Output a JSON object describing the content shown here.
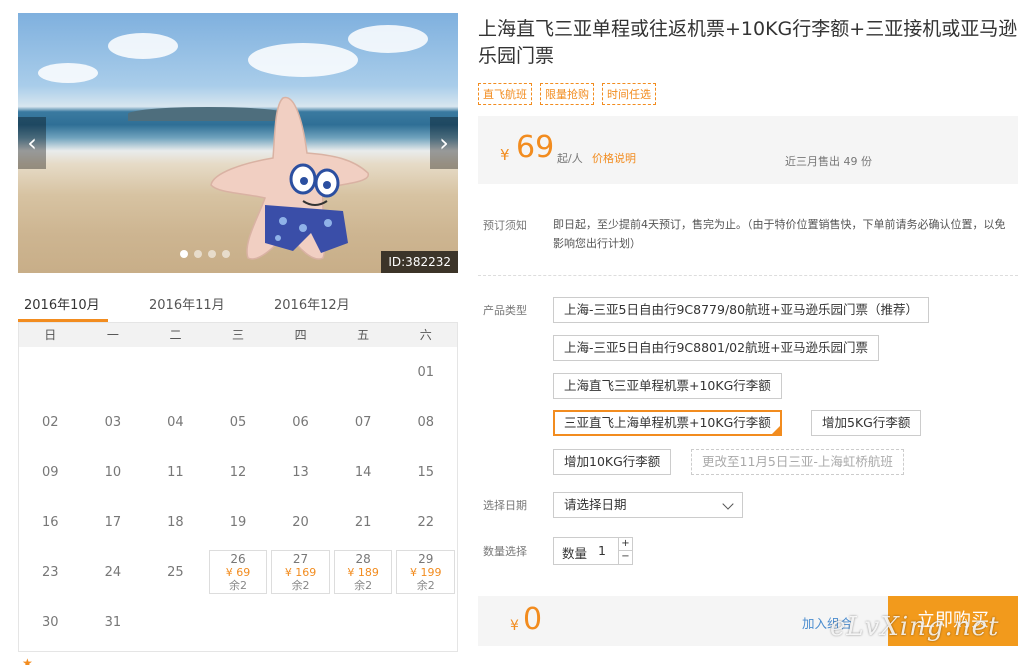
{
  "gallery": {
    "id_label": "ID:382232",
    "prev_icon": "‹",
    "next_icon": "›"
  },
  "calendar": {
    "tabs": [
      "2016年10月",
      "2016年11月",
      "2016年12月"
    ],
    "weekdays": [
      "日",
      "一",
      "二",
      "三",
      "四",
      "五",
      "六"
    ],
    "days": [
      {
        "d": ""
      },
      {
        "d": ""
      },
      {
        "d": ""
      },
      {
        "d": ""
      },
      {
        "d": ""
      },
      {
        "d": ""
      },
      {
        "d": "01"
      },
      {
        "d": "02"
      },
      {
        "d": "03"
      },
      {
        "d": "04"
      },
      {
        "d": "05"
      },
      {
        "d": "06"
      },
      {
        "d": "07"
      },
      {
        "d": "08"
      },
      {
        "d": "09"
      },
      {
        "d": "10"
      },
      {
        "d": "11"
      },
      {
        "d": "12"
      },
      {
        "d": "13"
      },
      {
        "d": "14"
      },
      {
        "d": "15"
      },
      {
        "d": "16"
      },
      {
        "d": "17"
      },
      {
        "d": "18"
      },
      {
        "d": "19"
      },
      {
        "d": "20"
      },
      {
        "d": "21"
      },
      {
        "d": "22"
      },
      {
        "d": "23"
      },
      {
        "d": "24"
      },
      {
        "d": "25"
      },
      {
        "d": "26",
        "price": "¥ 69",
        "stock": "余2"
      },
      {
        "d": "27",
        "price": "¥ 169",
        "stock": "余2"
      },
      {
        "d": "28",
        "price": "¥ 189",
        "stock": "余2"
      },
      {
        "d": "29",
        "price": "¥ 199",
        "stock": "余2"
      },
      {
        "d": "30"
      },
      {
        "d": "31"
      }
    ]
  },
  "product": {
    "title": "上海直飞三亚单程或往返机票+10KG行李额+三亚接机或亚马逊乐园门票",
    "tags": [
      "直飞航班",
      "限量抢购",
      "时间任选"
    ],
    "price_currency": "¥",
    "price": "69",
    "price_unit": "起/人",
    "price_link": "价格说明",
    "sold_text": "近三月售出 49 份"
  },
  "notice": {
    "label": "预订须知",
    "text": "即日起，至少提前4天预订，售完为止。（由于特价位置销售快，下单前请务必确认位置，以免影响您出行计划）"
  },
  "options": {
    "label": "产品类型",
    "items": [
      "上海-三亚5日自由行9C8779/80航班+亚马逊乐园门票（推荐）",
      "上海-三亚5日自由行9C8801/02航班+亚马逊乐园门票",
      "上海直飞三亚单程机票+10KG行李额",
      "三亚直飞上海单程机票+10KG行李额",
      "增加5KG行李额",
      "增加10KG行李额",
      "更改至11月5日三亚-上海虹桥航班"
    ]
  },
  "date_select": {
    "label": "选择日期",
    "value": "请选择日期"
  },
  "quantity": {
    "label": "数量选择",
    "inner_label": "数量",
    "value": "1",
    "plus": "+",
    "minus": "−"
  },
  "purchase": {
    "currency": "¥",
    "total": "0",
    "add_cart": "加入组合",
    "buy_now": "立即购买"
  },
  "watermark": "eLvXing.net",
  "colors": {
    "accent": "#f28c1f",
    "link": "#4a8ccf",
    "buy_button": "#f29a1c"
  }
}
